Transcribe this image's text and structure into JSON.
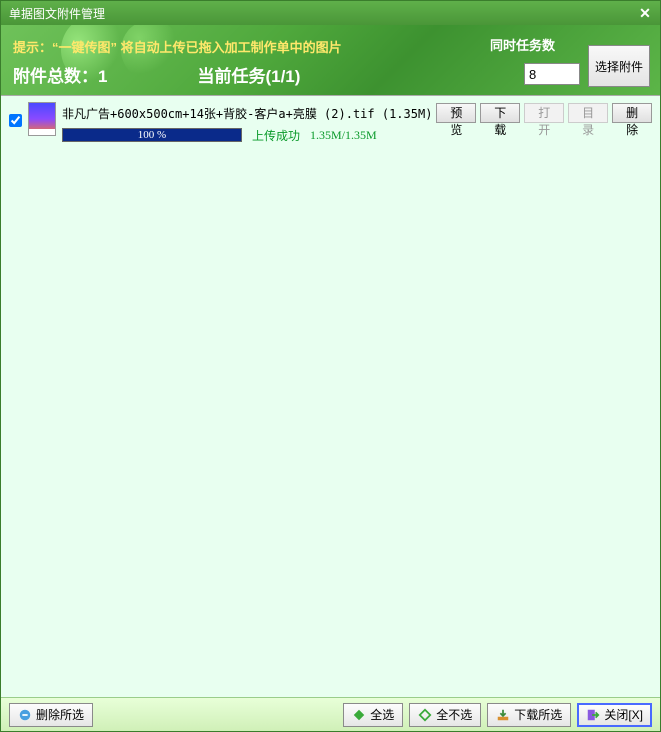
{
  "window": {
    "title": "单据图文附件管理"
  },
  "header": {
    "tip_prefix": "提示：",
    "tip_highlight": "“一键传图”",
    "tip_suffix": " 将自动上传已拖入加工制作单中的图片",
    "count_label": "附件总数：1",
    "current_task": "当前任务(1/1)",
    "concurrent_label": "同时任务数",
    "concurrent_value": "8",
    "select_button": "选择附件"
  },
  "items": [
    {
      "checked": true,
      "filename": "非凡广告+600x500cm+14张+背胶-客户a+亮膜 (2).tif (1.35M)",
      "buttons": {
        "preview": "预览",
        "download": "下载",
        "open": "打开",
        "folder": "目录",
        "delete": "删除"
      },
      "open_enabled": false,
      "folder_enabled": false,
      "progress_pct": 100,
      "progress_text": "100 %",
      "status": "上传成功",
      "size_text": "1.35M/1.35M"
    }
  ],
  "footer": {
    "delete_selected": "删除所选",
    "select_all": "全选",
    "select_none": "全不选",
    "download_selected": "下载所选",
    "close": "关闭[X]"
  }
}
